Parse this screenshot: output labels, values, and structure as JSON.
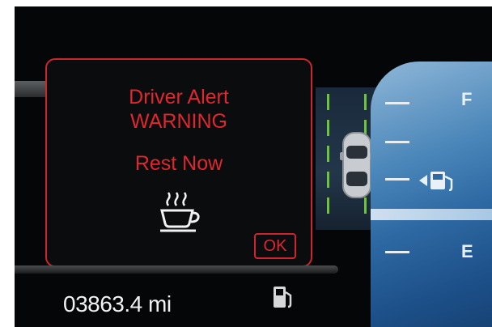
{
  "alert": {
    "line1": "Driver Alert",
    "line2": "WARNING",
    "line3": "Rest Now",
    "ok_label": "OK",
    "icon": "coffee-cup-icon",
    "color": "#e0262f"
  },
  "odometer": {
    "value": "03863.4 mi"
  },
  "fuel_gauge": {
    "full_label": "F",
    "empty_label": "E",
    "icon": "fuel-pump-icon",
    "side_indicator_icon": "fuel-door-left-arrow-icon"
  },
  "lane_display": {
    "icon": "car-top-view-icon",
    "lane_color": "#6ec43a"
  }
}
